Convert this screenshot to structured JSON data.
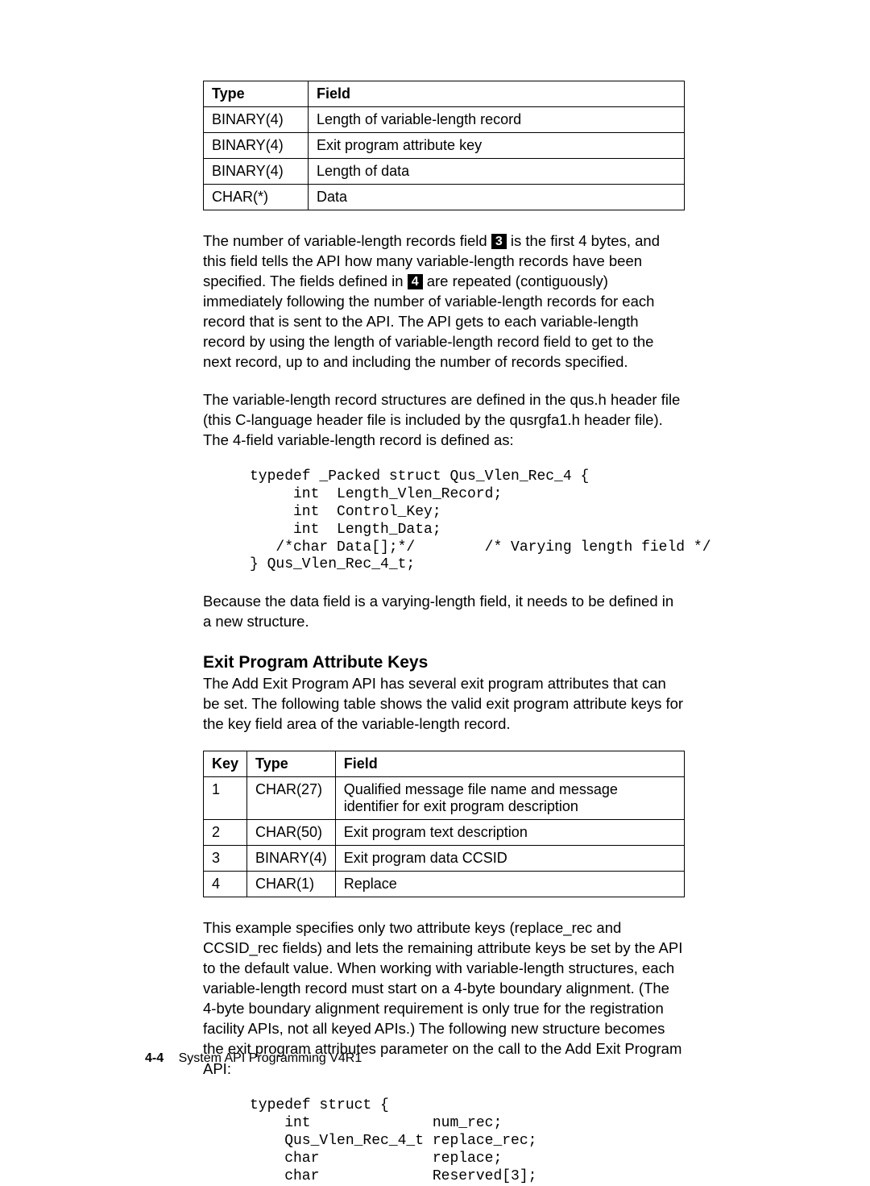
{
  "table1": {
    "head_type": "Type",
    "head_field": "Field",
    "rows": [
      {
        "type": "BINARY(4)",
        "field": "Length of variable-length record"
      },
      {
        "type": "BINARY(4)",
        "field": "Exit program attribute key"
      },
      {
        "type": "BINARY(4)",
        "field": "Length of data"
      },
      {
        "type": "CHAR(*)",
        "field": "Data"
      }
    ]
  },
  "para1a": "The number of variable-length records field ",
  "callout3": "3",
  "para1b": " is the first 4 bytes, and this field tells the API how many variable-length records have been specified.  The fields defined in ",
  "callout4": "4",
  "para1c": " are repeated (contiguously) immediately following the number of variable-length records for each record that is sent to the API.  The API gets to each variable-length record by using the length of variable-length record field to get to the next record, up to and including the number of records specified.",
  "para2": "The variable-length record structures are defined in the qus.h header file (this C-language header file is included by the qusrgfa1.h header file). The 4-field variable-length record is defined as:",
  "code1": "typedef _Packed struct Qus_Vlen_Rec_4 {\n     int  Length_Vlen_Record;\n     int  Control_Key;\n     int  Length_Data;\n   /*char Data[];*/        /* Varying length field */\n} Qus_Vlen_Rec_4_t;",
  "para3": "Because the data field is a varying-length field, it needs to be defined in a new structure.",
  "heading": "Exit Program Attribute Keys",
  "para4": "The Add Exit Program API has several exit program attributes that can be set.  The following table shows the valid exit program attribute keys for the key field area of the variable-length record.",
  "table2": {
    "head_key": "Key",
    "head_type": "Type",
    "head_field": "Field",
    "rows": [
      {
        "key": "1",
        "type": "CHAR(27)",
        "field": "Qualified message file name and message identifier for exit program description"
      },
      {
        "key": "2",
        "type": "CHAR(50)",
        "field": "Exit program text description"
      },
      {
        "key": "3",
        "type": "BINARY(4)",
        "field": "Exit program data CCSID"
      },
      {
        "key": "4",
        "type": "CHAR(1)",
        "field": "Replace"
      }
    ]
  },
  "para5": "This example specifies only two attribute keys (replace_rec and CCSID_rec fields) and lets the remaining attribute keys be set by the API to the default value.  When working with variable-length structures, each variable-length record must start on a 4-byte boundary alignment.  (The 4-byte boundary alignment requirement is only true for the registration facility APIs, not all keyed APIs.)  The following new structure becomes the exit program attributes parameter on the call to the Add Exit Program API:",
  "code2": "typedef struct {\n    int              num_rec;\n    Qus_Vlen_Rec_4_t replace_rec;\n    char             replace;\n    char             Reserved[3];",
  "footer_page": "4-4",
  "footer_text": "System API Programming V4R1"
}
